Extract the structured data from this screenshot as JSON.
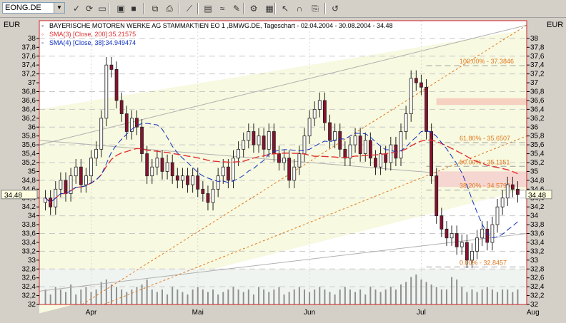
{
  "toolbar": {
    "symbol": "EONG.DE",
    "buttons": [
      {
        "icon": "chart-check-icon",
        "glyph": "✓"
      },
      {
        "icon": "refresh-icon",
        "glyph": "⟳"
      },
      {
        "icon": "new-document-icon",
        "glyph": "▭"
      },
      {
        "icon": "open-folder-icon",
        "glyph": "▣"
      },
      {
        "icon": "save-icon",
        "glyph": "■"
      },
      {
        "icon": "copy-icon",
        "glyph": "⧉"
      },
      {
        "icon": "print-icon",
        "glyph": "⎙"
      },
      {
        "icon": "line-tool-icon",
        "glyph": "⟋"
      },
      {
        "icon": "chart-style-icon",
        "glyph": "▤"
      },
      {
        "icon": "indicator-icon",
        "glyph": "≈"
      },
      {
        "icon": "drawing-tool-icon",
        "glyph": "✎"
      },
      {
        "icon": "settings-icon",
        "glyph": "⚙"
      },
      {
        "icon": "grid-icon",
        "glyph": "▦"
      },
      {
        "icon": "cursor-icon",
        "glyph": "↖"
      },
      {
        "icon": "magnet-icon",
        "glyph": "∩"
      },
      {
        "icon": "export-icon",
        "glyph": "⎘"
      },
      {
        "icon": "undo-icon",
        "glyph": "↺"
      }
    ]
  },
  "axis": {
    "left_unit": "EUR",
    "right_unit": "EUR"
  },
  "legend": {
    "title": "BAYERISCHE MOTOREN WERKE AG STAMMAKTIEN EO 1 ,BMWG.DE, Tageschart - 02.04.2004 - 30.08.2004 - 34.48",
    "sma1": "SMA(3) [Close, 200]:35.21575",
    "sma2": "SMA(4) [Close, 38]:34.949474"
  },
  "current_price_label": "34.48",
  "fib_labels": [
    {
      "text": "100.00% - 37.3846",
      "price": 37.3846
    },
    {
      "text": "61.80% - 35.6507",
      "price": 35.6507
    },
    {
      "text": "50.00% - 35.1151",
      "price": 35.1151
    },
    {
      "text": "38.20% - 34.5796",
      "price": 34.5796
    },
    {
      "text": "0.00% - 32.8457",
      "price": 32.8457
    }
  ],
  "colors": {
    "chart_bg": "#f7f9e0",
    "frame": "#d02020",
    "candle_up": "#ffffff",
    "candle_down": "#8b1030",
    "sma_red": "#e03030",
    "sma_blue": "#1030c0",
    "fib": "#e07820",
    "volume": "#909090"
  },
  "chart_data": {
    "type": "candlestick",
    "title": "BAYERISCHE MOTOREN WERKE AG STAMMAKTIEN EO 1 ,BMWG.DE, Tageschart - 02.04.2004 - 30.08.2004 - 34.48",
    "ylim": [
      32,
      38.4
    ],
    "y_ticks": [
      32,
      32.2,
      32.4,
      32.6,
      32.8,
      33,
      33.2,
      33.4,
      33.6,
      33.8,
      34,
      34.2,
      34.4,
      34.6,
      34.8,
      35,
      35.2,
      35.4,
      35.6,
      35.8,
      36,
      36.2,
      36.4,
      36.6,
      36.8,
      37,
      37.2,
      37.4,
      37.6,
      37.8,
      38
    ],
    "x_labels": [
      "Apr",
      "Mai",
      "Jun",
      "Jul",
      "Aug"
    ],
    "x_label_index": [
      9,
      30,
      52,
      74,
      96
    ],
    "close": [
      34.4,
      34.2,
      34.6,
      34.8,
      34.5,
      34.9,
      35.1,
      34.7,
      34.9,
      35.3,
      35.5,
      36.2,
      37.4,
      37.3,
      36.6,
      36.3,
      35.9,
      36.2,
      36.0,
      35.4,
      34.9,
      35.1,
      35.3,
      35.0,
      35.2,
      34.9,
      34.8,
      34.9,
      34.7,
      34.9,
      34.6,
      34.5,
      34.3,
      34.6,
      34.9,
      35.1,
      34.8,
      35.3,
      35.5,
      35.7,
      35.9,
      35.6,
      35.8,
      35.5,
      35.9,
      35.4,
      35.2,
      35.3,
      34.8,
      35.1,
      35.4,
      35.8,
      36.2,
      36.4,
      36.6,
      36.1,
      35.7,
      35.9,
      35.5,
      35.3,
      35.6,
      35.8,
      35.4,
      35.7,
      35.3,
      35.1,
      35.4,
      35.2,
      35.6,
      35.3,
      35.9,
      36.3,
      37.1,
      37.0,
      36.9,
      35.9,
      34.9,
      34.0,
      33.7,
      33.5,
      33.6,
      33.3,
      33.4,
      33.0,
      33.2,
      33.5,
      33.7,
      33.4,
      33.8,
      34.2,
      34.4,
      34.7,
      34.6,
      34.48
    ],
    "volume": [
      0.3,
      0.2,
      0.35,
      0.3,
      0.25,
      0.4,
      0.2,
      0.3,
      0.35,
      0.25,
      0.3,
      0.45,
      0.5,
      0.4,
      0.35,
      0.3,
      0.25,
      0.3,
      0.35,
      0.4,
      0.5,
      0.3,
      0.25,
      0.3,
      0.2,
      0.35,
      0.3,
      0.25,
      0.2,
      0.3,
      0.35,
      0.3,
      0.25,
      0.3,
      0.2,
      0.25,
      0.3,
      0.35,
      0.3,
      0.25,
      0.3,
      0.2,
      0.35,
      0.3,
      0.25,
      0.3,
      0.35,
      0.2,
      0.25,
      0.3,
      0.35,
      0.3,
      0.25,
      0.3,
      0.35,
      0.3,
      0.25,
      0.2,
      0.3,
      0.35,
      0.3,
      0.25,
      0.3,
      0.2,
      0.35,
      0.3,
      0.25,
      0.3,
      0.35,
      0.3,
      0.4,
      0.45,
      0.55,
      0.6,
      0.5,
      0.45,
      0.4,
      0.35,
      0.3,
      0.3,
      0.55,
      0.5,
      0.35,
      0.25,
      0.3,
      0.25,
      0.3,
      0.35,
      0.3,
      0.25,
      0.3,
      0.3,
      0.25,
      0.3
    ]
  }
}
